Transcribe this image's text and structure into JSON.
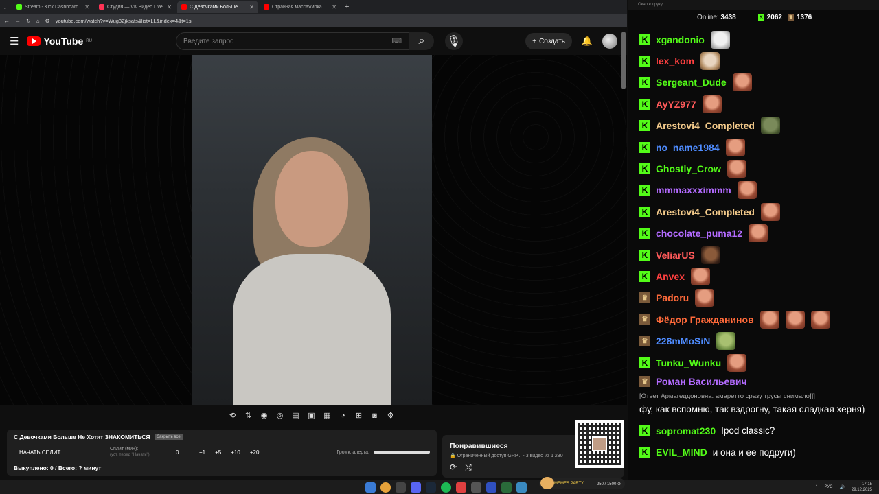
{
  "browser": {
    "tabs": [
      {
        "label": "Stream - Kick Dashboard",
        "color": "#53fc18",
        "active": false
      },
      {
        "label": "Студия — VK Видео Live",
        "color": "#ff3355",
        "active": false
      },
      {
        "label": "С Девочками Больше Не Хотя",
        "color": "#ff0000",
        "active": true
      },
      {
        "label": "Странная массажирка 🍔 Вид",
        "color": "#ff0000",
        "active": false
      }
    ],
    "url": "youtube.com/watch?v=Wug3Zjksafs&list=LL&index=4&t=1s"
  },
  "youtube": {
    "logo": "YouTube",
    "region": "RU",
    "search_placeholder": "Введите запрос",
    "create_label": "Создать"
  },
  "stream_panel": {
    "title": "С Девочками Больше Не Хотят ЗНАКОМИТЬСЯ",
    "tag": "Закрыть все",
    "start_split": "НАЧАТЬ СПЛИТ",
    "split_label": "Сплит (мин):",
    "split_hint": "(уст. перед \"Начать\")",
    "split_value": "0",
    "increments": [
      "+1",
      "+5",
      "+10",
      "+20"
    ],
    "alert_volume_label": "Громк. алерта:",
    "alert_volume": 1.0,
    "stats": "Выкуплено: 0 / Всего: ? минут"
  },
  "playlist": {
    "title": "Понравившиеся",
    "subtitle": "🔒 Ограниченный доступ GRP...",
    "position": "3 видео из 1 230"
  },
  "chat": {
    "window_title": "Окно в друку",
    "online_label": "Online:",
    "online_count": "3438",
    "kick_count": "2062",
    "other_count": "1376",
    "messages": [
      {
        "user": "xgandonio",
        "color": "#53fc18",
        "badge": "K",
        "emotes": [
          "cat"
        ]
      },
      {
        "user": "lex_kom",
        "color": "#ff4040",
        "badge": "K",
        "emotes": [
          "dog"
        ]
      },
      {
        "user": "Sergeant_Dude",
        "color": "#53fc18",
        "badge": "K",
        "emotes": [
          "face"
        ]
      },
      {
        "user": "AyYZ977",
        "color": "#ff5a5a",
        "badge": "K",
        "emotes": [
          "face"
        ]
      },
      {
        "user": "Arestovi4_Completed",
        "color": "#f2c98a",
        "badge": "K",
        "emotes": [
          "frog"
        ]
      },
      {
        "user": "no_name1984",
        "color": "#4f8cff",
        "badge": "K",
        "emotes": [
          "face"
        ]
      },
      {
        "user": "Ghostly_Crow",
        "color": "#53fc18",
        "badge": "K",
        "emotes": [
          "face"
        ]
      },
      {
        "user": "mmmaxxximmm",
        "color": "#b36bff",
        "badge": "K",
        "emotes": [
          "face"
        ]
      },
      {
        "user": "Arestovi4_Completed",
        "color": "#f2c98a",
        "badge": "K",
        "emotes": [
          "face"
        ]
      },
      {
        "user": "chocolate_puma12",
        "color": "#b36bff",
        "badge": "K",
        "emotes": [
          "face"
        ]
      },
      {
        "user": "VeliarUS",
        "color": "#ff5a5a",
        "badge": "K",
        "emotes": [
          "dark"
        ]
      },
      {
        "user": "Anvex",
        "color": "#ff4040",
        "badge": "K",
        "emotes": [
          "face"
        ]
      },
      {
        "user": "Padoru",
        "color": "#ff6a3a",
        "badge": "crown",
        "emotes": [
          "face"
        ]
      },
      {
        "user": "Фёдор Гражданинов",
        "color": "#ff6a3a",
        "badge": "crown",
        "emotes": [
          "face",
          "face",
          "face"
        ]
      },
      {
        "user": "228mMoSiN",
        "color": "#4f8cff",
        "badge": "crown",
        "emotes": [
          "pepe"
        ]
      },
      {
        "user": "Tunku_Wunku",
        "color": "#53fc18",
        "badge": "K",
        "emotes": [
          "face"
        ]
      }
    ],
    "reply_message": {
      "user": "Роман Васильевич",
      "color": "#b36bff",
      "reply": "[Ответ Армагеддоновна: амаретто сразу трусы снимало]]]",
      "text": "фу, как вспомню, так вздрогну, такая сладкая херня)"
    },
    "tail_messages": [
      {
        "user": "sopromat230",
        "color": "#53fc18",
        "text": "Ipod classic?"
      },
      {
        "user": "EVIL_MIND",
        "color": "#53fc18",
        "text": "и она и ее подруги)"
      }
    ]
  },
  "taskbar": {
    "memes_label": "MEMES PARTY",
    "memes_progress": "250 / 1500 ⊘",
    "lang": "РУС",
    "time": "17:15",
    "date": "29.12.2025"
  }
}
